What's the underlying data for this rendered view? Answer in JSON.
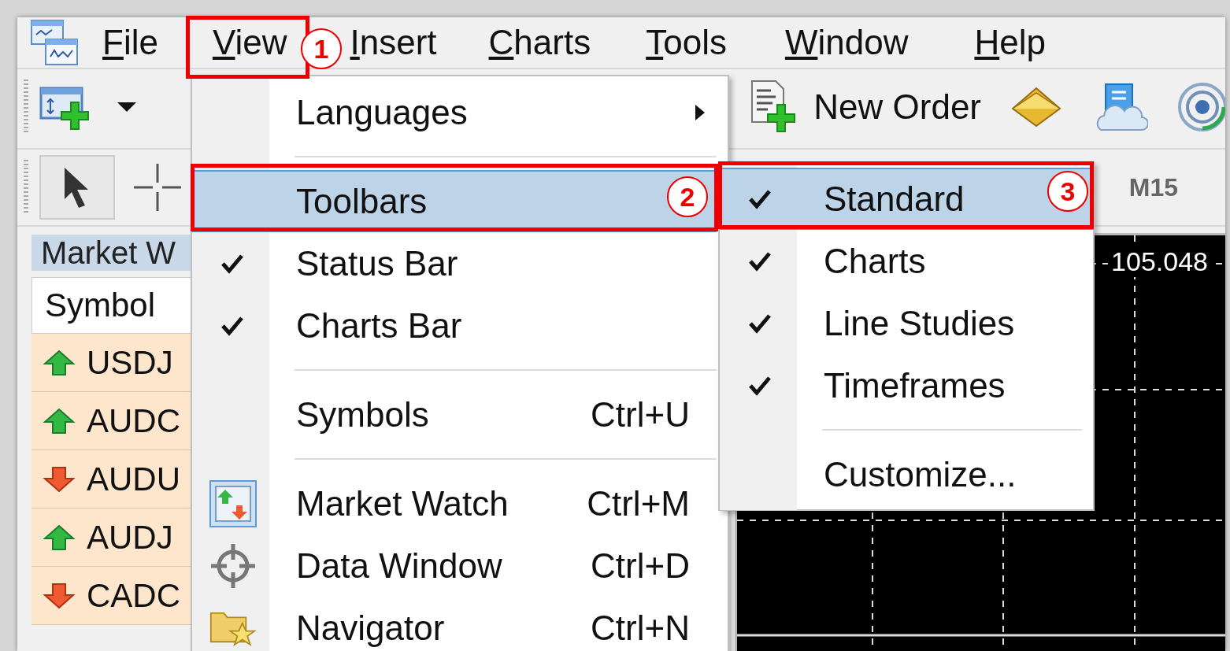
{
  "menubar": {
    "items": [
      {
        "label": "File",
        "underline_first": true
      },
      {
        "label": "View",
        "underline_first": true
      },
      {
        "label": "Insert",
        "underline_first": true
      },
      {
        "label": "Charts",
        "underline_first": true
      },
      {
        "label": "Tools",
        "underline_first": true
      },
      {
        "label": "Window",
        "underline_first": true
      },
      {
        "label": "Help",
        "underline_first": true
      }
    ]
  },
  "toolbar": {
    "new_order": "New Order"
  },
  "timeframes": {
    "items": [
      {
        "label": "M15"
      }
    ]
  },
  "market_watch": {
    "title": "Market W",
    "column": "Symbol",
    "rows": [
      {
        "symbol": "USDJ",
        "kind": "up"
      },
      {
        "symbol": "AUDC",
        "kind": "up"
      },
      {
        "symbol": "AUDU",
        "kind": "down"
      },
      {
        "symbol": "AUDJ",
        "kind": "up"
      },
      {
        "symbol": "CADC",
        "kind": "down"
      }
    ]
  },
  "chart": {
    "price_label": "105.048"
  },
  "view_menu": {
    "items": [
      {
        "kind": "item",
        "label": "Languages",
        "submenu": true,
        "checked": false,
        "selected": false
      },
      {
        "kind": "separator"
      },
      {
        "kind": "item",
        "label": "Toolbars",
        "submenu": false,
        "checked": false,
        "selected": true
      },
      {
        "kind": "item",
        "label": "Status Bar",
        "submenu": false,
        "checked": true,
        "selected": false
      },
      {
        "kind": "item",
        "label": "Charts Bar",
        "submenu": false,
        "checked": true,
        "selected": false
      },
      {
        "kind": "separator"
      },
      {
        "kind": "item",
        "label": "Symbols",
        "shortcut": "Ctrl+U",
        "submenu": false,
        "checked": false,
        "selected": false
      },
      {
        "kind": "separator"
      },
      {
        "kind": "icon_item",
        "label": "Market Watch",
        "shortcut": "Ctrl+M",
        "submenu": false,
        "checked": true,
        "selected": false
      },
      {
        "kind": "icon_item",
        "label": "Data Window",
        "shortcut": "Ctrl+D",
        "submenu": false,
        "checked": false,
        "selected": false
      },
      {
        "kind": "icon_item",
        "label": "Navigator",
        "shortcut": "Ctrl+N",
        "submenu": false,
        "checked": false,
        "selected": false
      }
    ]
  },
  "toolbars_menu": {
    "items": [
      {
        "kind": "item",
        "label": "Standard",
        "checked": true,
        "selected": true
      },
      {
        "kind": "item",
        "label": "Charts",
        "checked": true,
        "selected": false
      },
      {
        "kind": "item",
        "label": "Line Studies",
        "checked": true,
        "selected": false
      },
      {
        "kind": "item",
        "label": "Timeframes",
        "checked": true,
        "selected": false
      },
      {
        "kind": "separator"
      },
      {
        "kind": "item",
        "label": "Customize...",
        "checked": false,
        "selected": false
      }
    ]
  },
  "annotations": [
    {
      "number": "1"
    },
    {
      "number": "2"
    },
    {
      "number": "3"
    }
  ]
}
